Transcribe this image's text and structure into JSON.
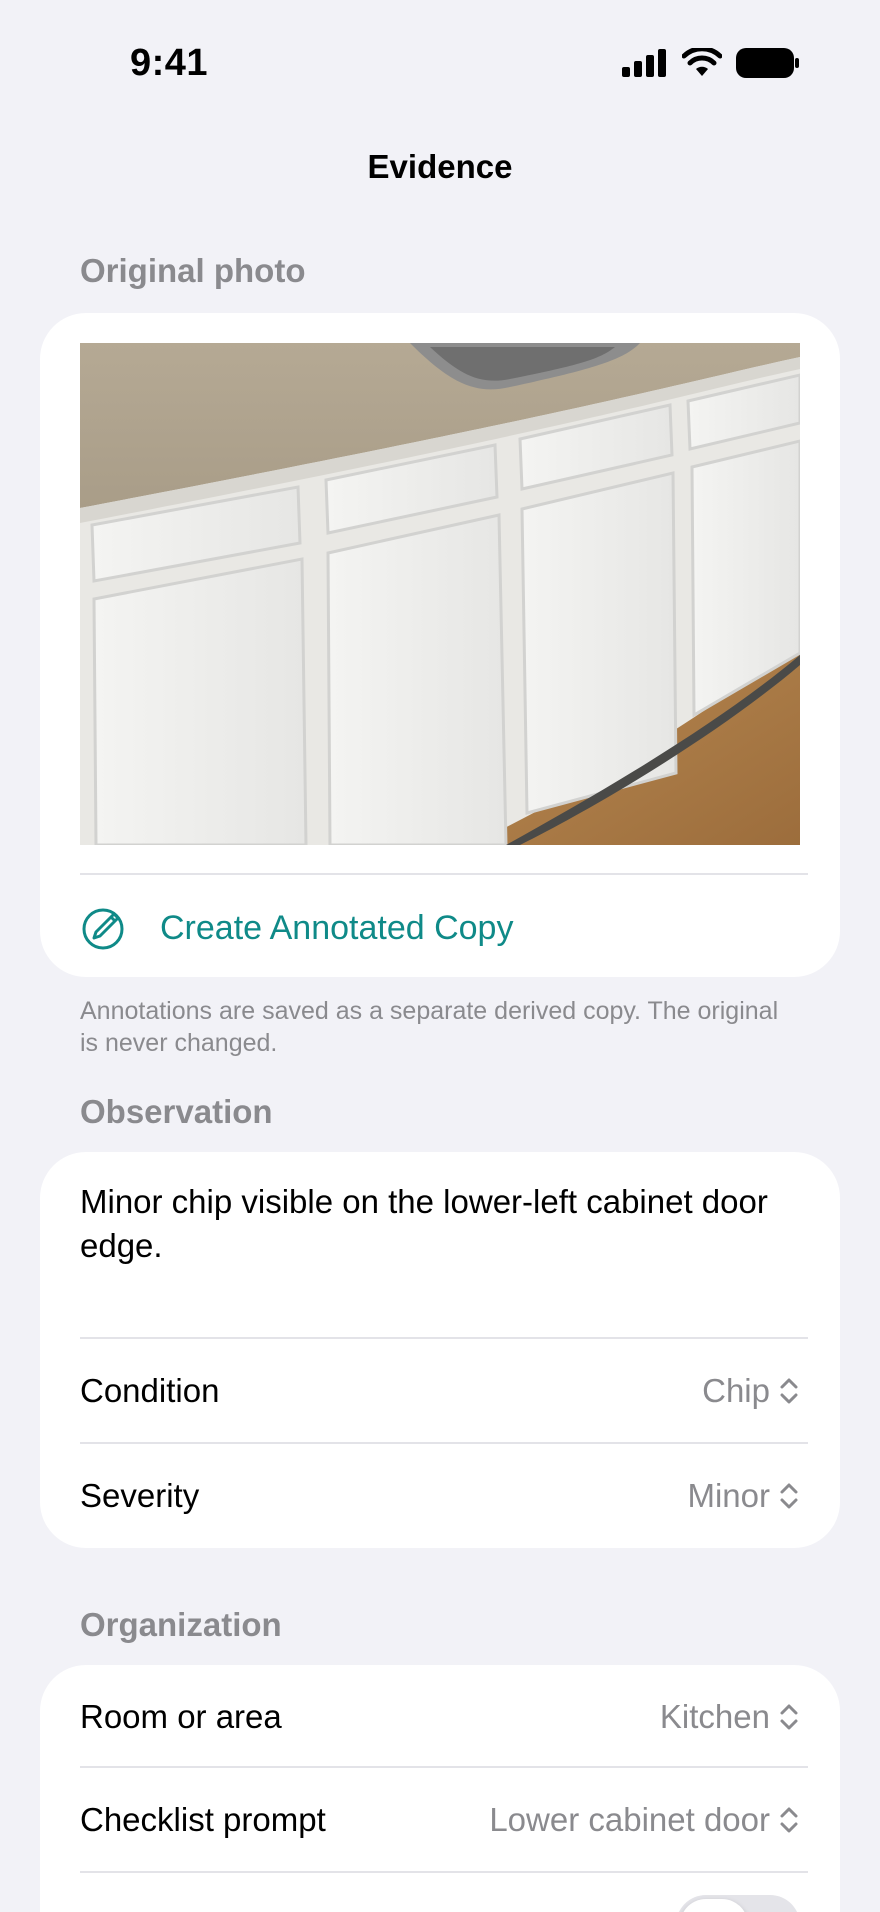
{
  "status_bar": {
    "time": "9:41"
  },
  "nav": {
    "title": "Evidence"
  },
  "original_photo": {
    "header": "Original photo",
    "annotate_label": "Create Annotated Copy",
    "footnote": "Annotations are saved as a separate derived copy. The original is never changed."
  },
  "observation": {
    "header": "Observation",
    "text": "Minor chip visible on the lower-left cabinet door edge.",
    "condition_label": "Condition",
    "condition_value": "Chip",
    "severity_label": "Severity",
    "severity_value": "Minor"
  },
  "organization": {
    "header": "Organization",
    "room_label": "Room or area",
    "room_value": "Kitchen",
    "prompt_label": "Checklist prompt",
    "prompt_value": "Lower cabinet door"
  },
  "colors": {
    "accent": "#0f8a88",
    "background": "#f2f2f7",
    "secondary_text": "#8a8a8e"
  }
}
